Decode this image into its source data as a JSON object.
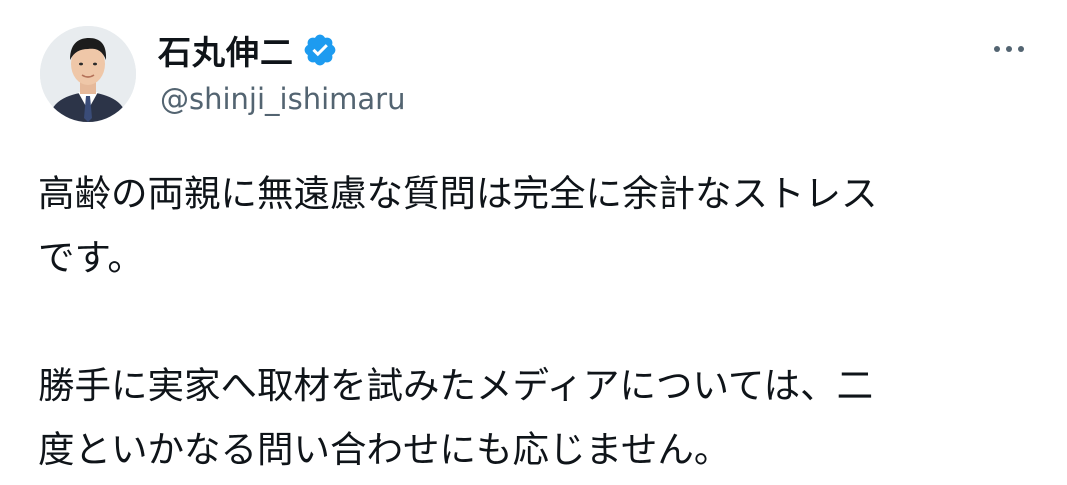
{
  "author": {
    "display_name": "石丸伸二",
    "handle": "@shinji_ishimaru",
    "verified_icon": "verified-badge-icon",
    "avatar_icon": "profile-photo"
  },
  "tweet": {
    "paragraphs": [
      [
        "高齢の両親に無遠慮な質問は完全に余計なストレス",
        "です。"
      ],
      [
        "勝手に実家へ取材を試みたメディアについては、二",
        "度といかなる問い合わせにも応じません。"
      ]
    ]
  },
  "menu": {
    "more_icon": "more-options-icon"
  },
  "colors": {
    "text": "#0f1419",
    "secondary": "#536471",
    "verified": "#1d9bf0"
  }
}
